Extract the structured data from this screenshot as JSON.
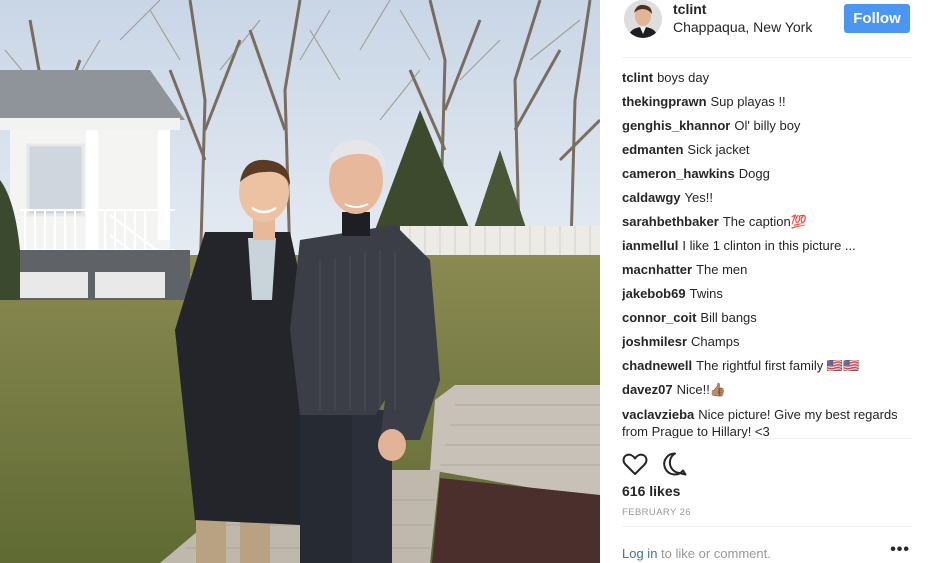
{
  "post": {
    "username": "tclint",
    "location": "Chappaqua, New York",
    "follow_label": "Follow"
  },
  "comments": [
    {
      "user": "tclint",
      "text": "boys day"
    },
    {
      "user": "thekingprawn",
      "text": "Sup playas !!"
    },
    {
      "user": "genghis_khannor",
      "text": "Ol' billy boy"
    },
    {
      "user": "edmanten",
      "text": "Sick jacket"
    },
    {
      "user": "cameron_hawkins",
      "text": "Dogg"
    },
    {
      "user": "caldawgy",
      "text": "Yes!!"
    },
    {
      "user": "sarahbethbaker",
      "text": "The caption💯"
    },
    {
      "user": "ianmellul",
      "text": "I like 1 clinton in this picture ..."
    },
    {
      "user": "macnhatter",
      "text": "The men"
    },
    {
      "user": "jakebob69",
      "text": "Twins"
    },
    {
      "user": "connor_coit",
      "text": "Bill bangs"
    },
    {
      "user": "joshmilesr",
      "text": "Champs"
    },
    {
      "user": "chadnewell",
      "text": "The rightful first family 🇺🇸🇺🇸"
    },
    {
      "user": "davez07",
      "text": "Nice!!👍🏽"
    },
    {
      "user": "vaclavzieba",
      "text": "Nice picture! Give my best regards from Prague to Hillary! <3"
    }
  ],
  "stats": {
    "likes": "616 likes",
    "date": "FEBRUARY 26"
  },
  "footer": {
    "login_link": "Log in",
    "login_rest": " to like or comment.",
    "more": "•••"
  },
  "icons": {
    "like": "heart-icon",
    "comment": "comment-icon",
    "more": "more-options-icon"
  },
  "colors": {
    "follow": "#4b96f0",
    "link": "#3f729b",
    "muted": "#999999",
    "text": "#262626"
  }
}
